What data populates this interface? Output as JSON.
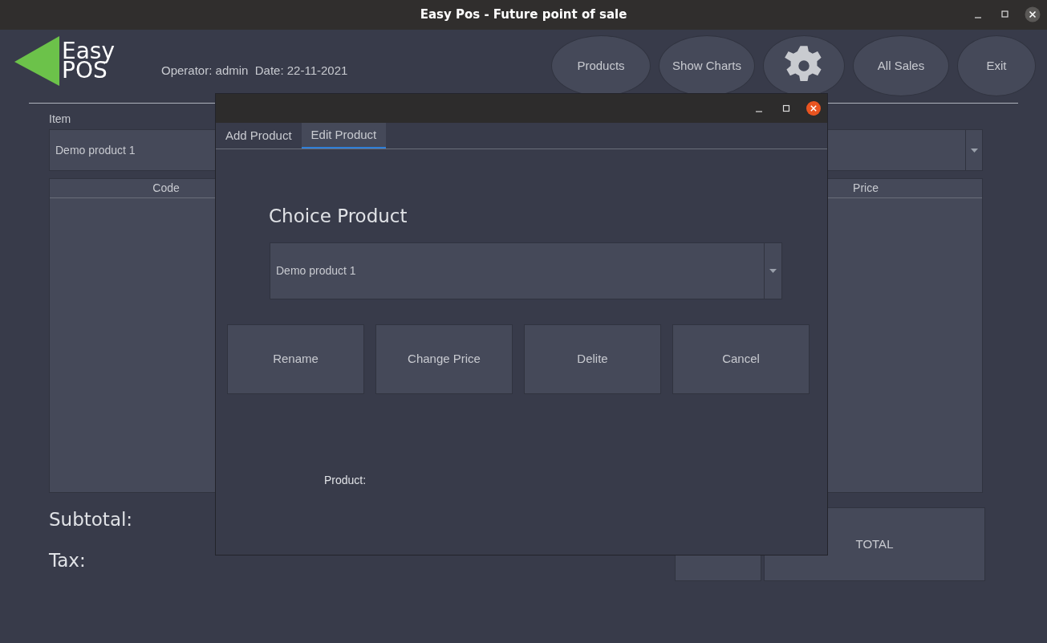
{
  "window": {
    "title": "Easy Pos - Future point of sale"
  },
  "logo": {
    "line_1": "Easy",
    "line_2": "POS"
  },
  "operator_info": "Operator: admin  Date: 22-11-2021",
  "toolbar": [
    {
      "kind": "text",
      "label": "Products"
    },
    {
      "kind": "text",
      "label": "Show Charts"
    },
    {
      "kind": "settings"
    },
    {
      "kind": "text",
      "label": "All Sales"
    },
    {
      "kind": "text",
      "label": "Exit"
    }
  ],
  "item_label": "Item",
  "item_combo": {
    "value": "Demo product 1"
  },
  "table": {
    "columns": [
      "Code",
      "",
      "Price"
    ]
  },
  "totals": {
    "subtotal_label": "Subtotal:",
    "tax_label": "Tax:",
    "total_button": "TOTAL"
  },
  "dialog": {
    "tabs": [
      {
        "label": "Add Product",
        "selected": false
      },
      {
        "label": "Edit Product",
        "selected": true
      }
    ],
    "heading": "Choice Product",
    "product_combo": {
      "value": "Demo product 1"
    },
    "buttons": [
      "Rename",
      "Change Price",
      "Delite",
      "Cancel"
    ],
    "product_label": "Product:"
  }
}
